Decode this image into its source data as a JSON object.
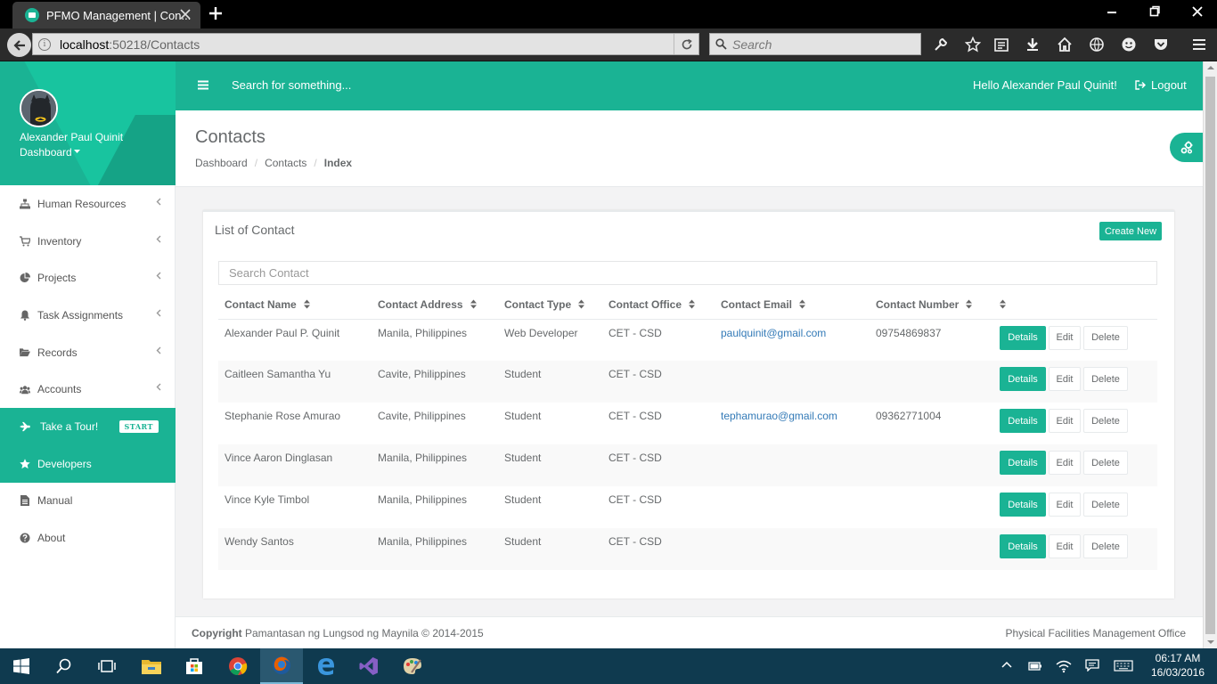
{
  "browser": {
    "tab_title": "PFMO Management | Con...",
    "url_host": "localhost",
    "url_rest": ":50218/Contacts",
    "search_placeholder": "Search"
  },
  "sidebar": {
    "user_name": "Alexander Paul Quinit",
    "dashboard_label": "Dashboard",
    "items": [
      {
        "label": "Human Resources",
        "icon": "sitemap-icon"
      },
      {
        "label": "Inventory",
        "icon": "cart-icon"
      },
      {
        "label": "Projects",
        "icon": "pie-chart-icon"
      },
      {
        "label": "Task Assignments",
        "icon": "bell-icon"
      },
      {
        "label": "Records",
        "icon": "folder-icon"
      },
      {
        "label": "Accounts",
        "icon": "users-icon"
      }
    ],
    "tour_label": "Take a Tour!",
    "tour_badge": "START",
    "developers_label": "Developers",
    "manual_label": "Manual",
    "about_label": "About"
  },
  "header": {
    "search_placeholder": "Search for something...",
    "greeting": "Hello Alexander Paul Quinit!",
    "logout_label": "Logout"
  },
  "page": {
    "title": "Contacts",
    "breadcrumb": [
      "Dashboard",
      "Contacts",
      "Index"
    ]
  },
  "panel": {
    "title": "List of Contact",
    "create_label": "Create New",
    "search_placeholder": "Search Contact",
    "columns": [
      "Contact Name",
      "Contact Address",
      "Contact Type",
      "Contact Office",
      "Contact Email",
      "Contact Number",
      ""
    ],
    "rows": [
      {
        "name": "Alexander Paul P. Quinit",
        "address": "Manila, Philippines",
        "type": "Web Developer",
        "office": "CET - CSD",
        "email": "paulquinit@gmail.com",
        "number": "09754869837"
      },
      {
        "name": "Caitleen Samantha Yu",
        "address": "Cavite, Philippines",
        "type": "Student",
        "office": "CET - CSD",
        "email": "",
        "number": ""
      },
      {
        "name": "Stephanie Rose Amurao",
        "address": "Cavite, Philippines",
        "type": "Student",
        "office": "CET - CSD",
        "email": "tephamurao@gmail.com",
        "number": "09362771004"
      },
      {
        "name": "Vince Aaron Dinglasan",
        "address": "Manila, Philippines",
        "type": "Student",
        "office": "CET - CSD",
        "email": "",
        "number": ""
      },
      {
        "name": "Vince Kyle Timbol",
        "address": "Manila, Philippines",
        "type": "Student",
        "office": "CET - CSD",
        "email": "",
        "number": ""
      },
      {
        "name": "Wendy Santos",
        "address": "Manila, Philippines",
        "type": "Student",
        "office": "CET - CSD",
        "email": "",
        "number": ""
      }
    ],
    "actions": {
      "details": "Details",
      "edit": "Edit",
      "delete": "Delete"
    }
  },
  "footer": {
    "copyright_bold": "Copyright",
    "copyright_text": " Pamantasan ng Lungsod ng Maynila © 2014-2015",
    "office": "Physical Facilities Management Office"
  },
  "taskbar": {
    "time": "06:17 AM",
    "date": "16/03/2016"
  },
  "colors": {
    "accent": "#1ab394",
    "link": "#337ab7",
    "taskbar": "#0f3a4f"
  }
}
